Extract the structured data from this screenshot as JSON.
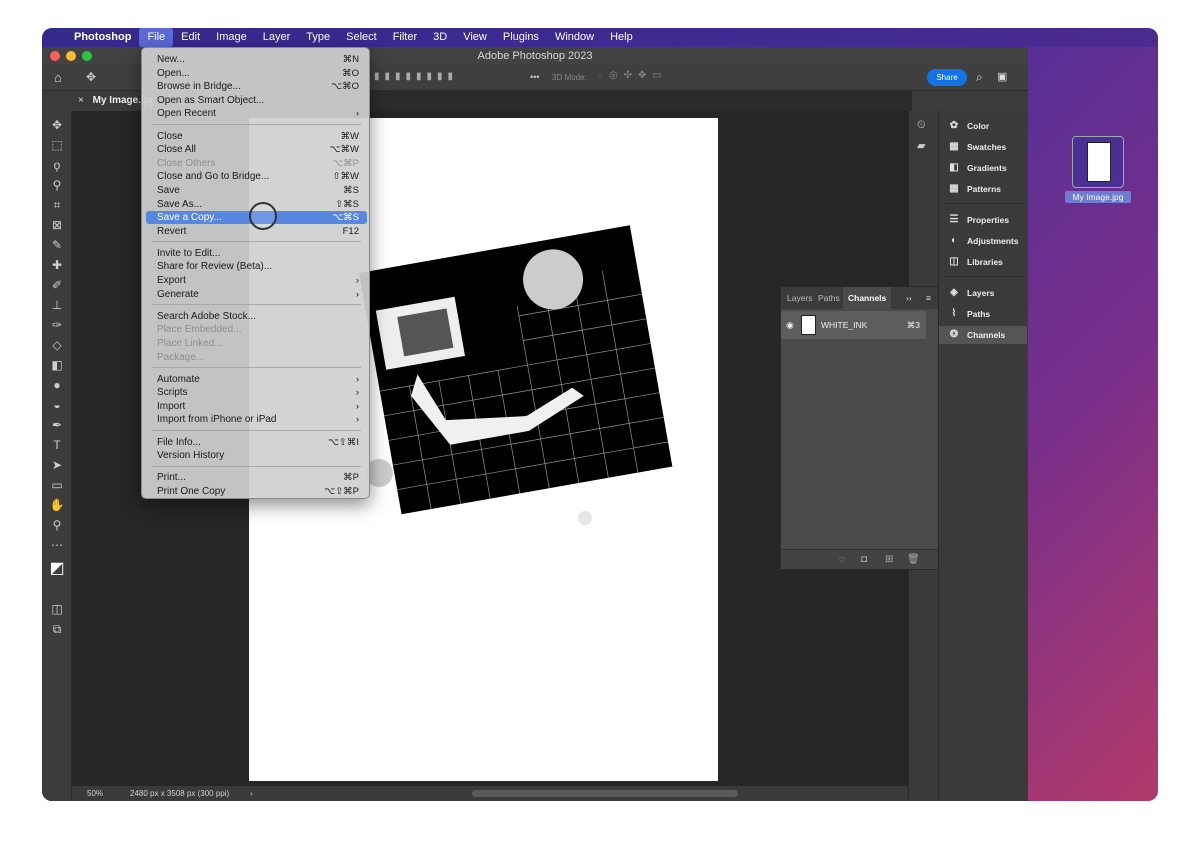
{
  "menubar": {
    "apple": "",
    "items": [
      "Photoshop",
      "File",
      "Edit",
      "Image",
      "Layer",
      "Type",
      "Select",
      "Filter",
      "3D",
      "View",
      "Plugins",
      "Window",
      "Help"
    ]
  },
  "window": {
    "title": "Adobe Photoshop 2023",
    "doc_tab_close": "×",
    "doc_tab": "My Image.jpg"
  },
  "options_bar": {
    "mode_label": "3D Mode:",
    "more": "•••",
    "share": "Share"
  },
  "file_menu": {
    "items": [
      {
        "label": "New...",
        "shortcut": "⌘N",
        "disabled": false
      },
      {
        "label": "Open...",
        "shortcut": "⌘O",
        "disabled": false
      },
      {
        "label": "Browse in Bridge...",
        "shortcut": "⌥⌘O",
        "disabled": false
      },
      {
        "label": "Open as Smart Object...",
        "shortcut": "",
        "disabled": false
      },
      {
        "label": "Open Recent",
        "shortcut": "›",
        "disabled": false
      },
      {
        "label": "Close",
        "shortcut": "⌘W",
        "disabled": false
      },
      {
        "label": "Close All",
        "shortcut": "⌥⌘W",
        "disabled": false
      },
      {
        "label": "Close Others",
        "shortcut": "⌥⌘P",
        "disabled": true
      },
      {
        "label": "Close and Go to Bridge...",
        "shortcut": "⇧⌘W",
        "disabled": false
      },
      {
        "label": "Save",
        "shortcut": "⌘S",
        "disabled": false
      },
      {
        "label": "Save As...",
        "shortcut": "⇧⌘S",
        "disabled": false
      },
      {
        "label": "Save a Copy...",
        "shortcut": "⌥⌘S",
        "disabled": false,
        "highlighted": true
      },
      {
        "label": "Revert",
        "shortcut": "F12",
        "disabled": false
      },
      {
        "label": "Invite to Edit...",
        "shortcut": "",
        "disabled": false
      },
      {
        "label": "Share for Review (Beta)...",
        "shortcut": "",
        "disabled": false
      },
      {
        "label": "Export",
        "shortcut": "›",
        "disabled": false
      },
      {
        "label": "Generate",
        "shortcut": "›",
        "disabled": false
      },
      {
        "label": "Search Adobe Stock...",
        "shortcut": "",
        "disabled": false
      },
      {
        "label": "Place Embedded...",
        "shortcut": "",
        "disabled": true
      },
      {
        "label": "Place Linked...",
        "shortcut": "",
        "disabled": true
      },
      {
        "label": "Package...",
        "shortcut": "",
        "disabled": true
      },
      {
        "label": "Automate",
        "shortcut": "›",
        "disabled": false
      },
      {
        "label": "Scripts",
        "shortcut": "›",
        "disabled": false
      },
      {
        "label": "Import",
        "shortcut": "›",
        "disabled": false
      },
      {
        "label": "Import from iPhone or iPad",
        "shortcut": "›",
        "disabled": false
      },
      {
        "label": "File Info...",
        "shortcut": "⌥⇧⌘I",
        "disabled": false
      },
      {
        "label": "Version History",
        "shortcut": "",
        "disabled": false
      },
      {
        "label": "Print...",
        "shortcut": "⌘P",
        "disabled": false
      },
      {
        "label": "Print One Copy",
        "shortcut": "⌥⇧⌘P",
        "disabled": false
      }
    ]
  },
  "channels_panel": {
    "tabs": [
      "Layers",
      "Paths",
      "Channels"
    ],
    "expand": "››",
    "menu": "≡",
    "row": {
      "name": "WHITE_INK",
      "shortcut": "⌘3"
    }
  },
  "right_panel": {
    "items": [
      "Color",
      "Swatches",
      "Gradients",
      "Patterns",
      "Properties",
      "Adjustments",
      "Libraries",
      "Layers",
      "Paths",
      "Channels"
    ],
    "selected": "Channels"
  },
  "status": {
    "zoom": "50%",
    "size": "2480 px x 3508 px (300 ppi)",
    "arrow": "›"
  },
  "desktop": {
    "file_label": "My Image.jpg"
  },
  "colors": {
    "highlight": "#5787e0",
    "share": "#1473e6"
  }
}
